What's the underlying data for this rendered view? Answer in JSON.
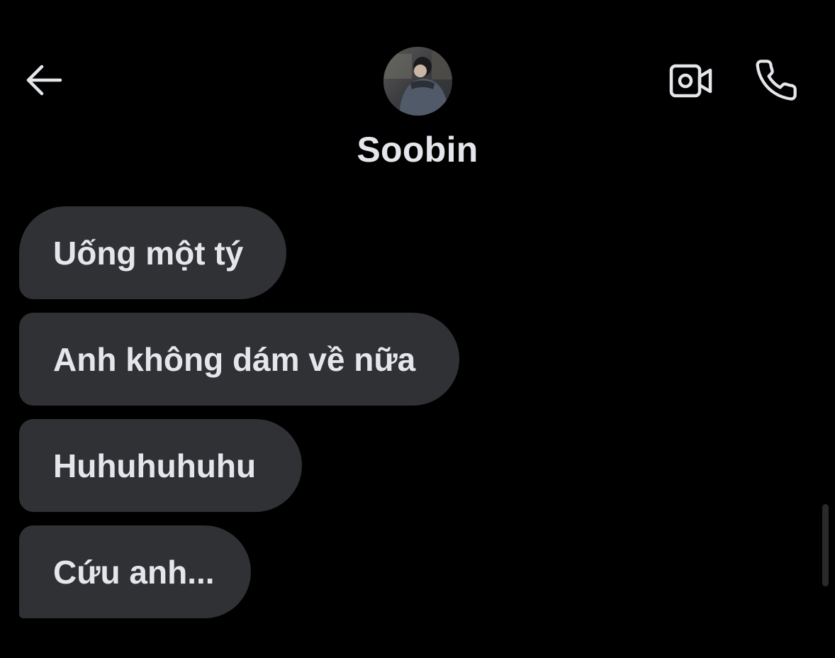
{
  "header": {
    "contact_name": "Soobin",
    "icons": {
      "back": "back-arrow-icon",
      "video": "video-camera-icon",
      "call": "phone-icon"
    }
  },
  "messages": [
    {
      "text": "Uống một tý"
    },
    {
      "text": "Anh không dám về nữa"
    },
    {
      "text": "Huhuhuhuhu"
    },
    {
      "text": "Cứu anh..."
    }
  ],
  "colors": {
    "background": "#000000",
    "bubble": "#303134",
    "text": "#e4e6eb"
  }
}
